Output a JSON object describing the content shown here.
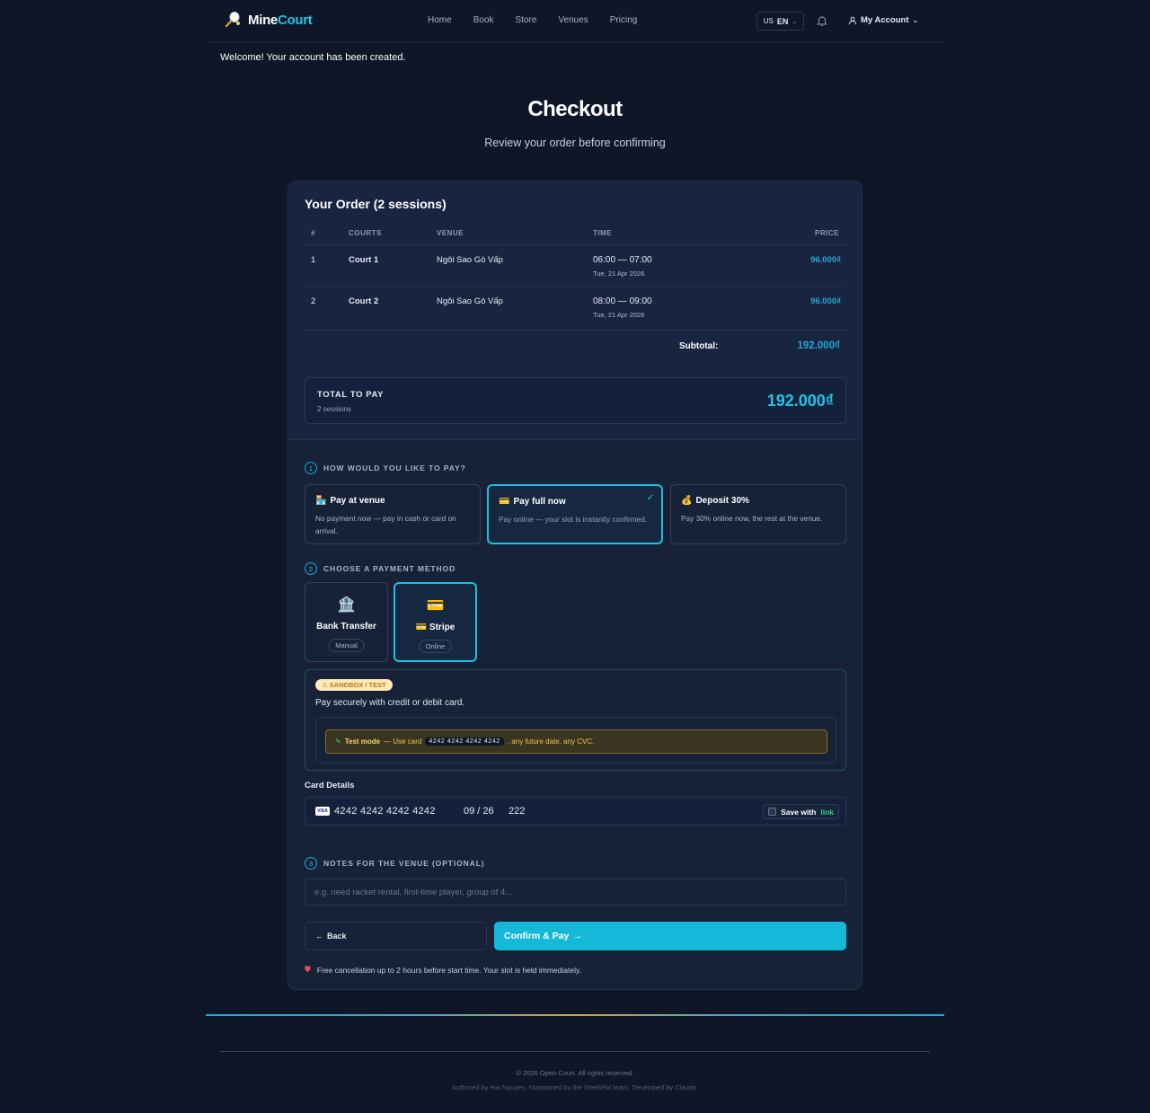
{
  "brand": {
    "name_part1": "Mine",
    "name_part2": "Court"
  },
  "nav": {
    "links": [
      "Home",
      "Book",
      "Store",
      "Venues",
      "Pricing"
    ],
    "lang_code": "US",
    "lang": "EN",
    "account": "My Account"
  },
  "flash": "Welcome! Your account has been created.",
  "page": {
    "title": "Checkout",
    "subtitle": "Review your order before confirming"
  },
  "order": {
    "title": "Your Order (2 sessions)",
    "columns": [
      "#",
      "COURTS",
      "VENUE",
      "TIME",
      "PRICE"
    ],
    "rows": [
      {
        "num": "1",
        "court": "Court 1",
        "venue": "Ngôi Sao Gò Vấp",
        "time": "06:00 — 07:00",
        "date": "Tue, 21 Apr 2026",
        "price": "96.000₫"
      },
      {
        "num": "2",
        "court": "Court 2",
        "venue": "Ngôi Sao Gò Vấp",
        "time": "08:00 — 09:00",
        "date": "Tue, 21 Apr 2026",
        "price": "96.000₫"
      }
    ],
    "subtotal_label": "Subtotal:",
    "subtotal": "192.000₫",
    "total_label": "TOTAL TO PAY",
    "total_sub": "2 sessions",
    "total": "192.000₫"
  },
  "step1": {
    "num": "1",
    "title": "HOW WOULD YOU LIKE TO PAY?",
    "options": [
      {
        "icon": "🏪",
        "title": "Pay at venue",
        "desc": "No payment now — pay in cash or card on arrival.",
        "selected": false
      },
      {
        "icon": "💳",
        "title": "Pay full now",
        "desc": "Pay online — your slot is instantly confirmed.",
        "selected": true
      },
      {
        "icon": "💰",
        "title": "Deposit 30%",
        "desc": "Pay 30% online now, the rest at the venue.",
        "selected": false
      }
    ]
  },
  "step2": {
    "num": "2",
    "title": "CHOOSE A PAYMENT METHOD",
    "methods": [
      {
        "icon": "🏦",
        "label": "Bank Transfer",
        "badge": "Manual",
        "selected": false
      },
      {
        "icon": "💳",
        "label": "💳 Stripe",
        "badge": "Online",
        "selected": true
      }
    ],
    "sandbox": "⚠ SANDBOX / TEST",
    "secure_text": "Pay securely with credit or debit card.",
    "test_label": "Test mode",
    "test_pre": "— Use card",
    "test_card": "4242 4242 4242 4242",
    "test_post": ", any future date, any CVC.",
    "card_details_label": "Card Details",
    "card_number": "4242 4242 4242 4242",
    "card_exp": "09 / 26",
    "card_cvc": "222",
    "save_with": "Save with",
    "save_link": "link"
  },
  "step3": {
    "num": "3",
    "title": "NOTES FOR THE VENUE (OPTIONAL)",
    "placeholder": "e.g. need racket rental, first-time player, group of 4..."
  },
  "actions": {
    "back": "Back",
    "confirm": "Confirm & Pay"
  },
  "cancel_note": "Free cancellation up to 2 hours before start time. Your slot is held immediately.",
  "footer": {
    "copyright": "© 2026 Open Court. All rights reserved.",
    "authored": "Authored by Hai Nguyen, Maintained by the WeebPal team, Developed by Claude."
  },
  "colors": {
    "accent": "#22c4e8",
    "background": "#0e1628",
    "card": "#172238",
    "confirm": "#15b8d8"
  }
}
